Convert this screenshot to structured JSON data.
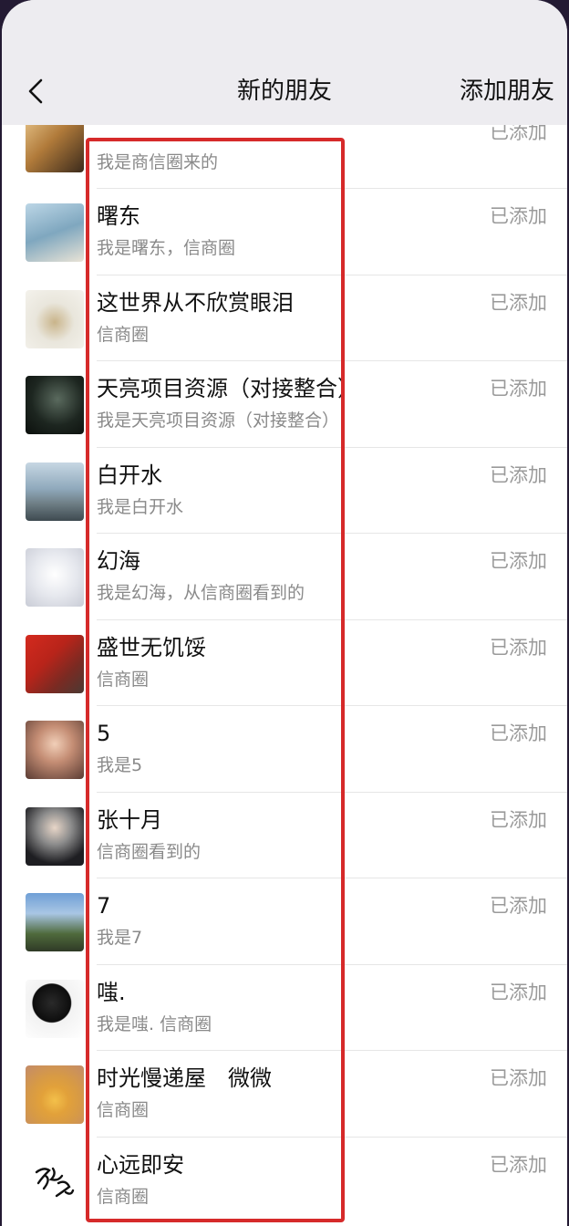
{
  "nav": {
    "back_icon": "chevron-left-icon",
    "title": "新的朋友",
    "add_label": "添加朋友"
  },
  "friends": [
    {
      "name": "",
      "message": "我是商信圈来的",
      "status": "已添加",
      "avatar": "photo"
    },
    {
      "name": "曙东",
      "message": "我是曙东，信商圈",
      "status": "已添加",
      "avatar": "photo"
    },
    {
      "name": "这世界从不欣赏眼泪",
      "message": "信商圈",
      "status": "已添加",
      "avatar": "photo"
    },
    {
      "name": "天亮项目资源（对接整合）",
      "message": "我是天亮项目资源（对接整合）",
      "status": "已添加",
      "avatar": "photo"
    },
    {
      "name": "白开水",
      "message": "我是白开水",
      "status": "已添加",
      "avatar": "photo"
    },
    {
      "name": "幻海",
      "message": "我是幻海，从信商圈看到的",
      "status": "已添加",
      "avatar": "photo"
    },
    {
      "name": "盛世无饥馁",
      "message": "信商圈",
      "status": "已添加",
      "avatar": "photo"
    },
    {
      "name": "5",
      "message": "我是5",
      "status": "已添加",
      "avatar": "photo"
    },
    {
      "name": "张十月",
      "message": "信商圈看到的",
      "status": "已添加",
      "avatar": "photo"
    },
    {
      "name": "7",
      "message": "我是7",
      "status": "已添加",
      "avatar": "photo"
    },
    {
      "name": "嗤.",
      "message": "我是嗤. 信商圈",
      "status": "已添加",
      "avatar": "photo"
    },
    {
      "name": "时光慢递屋　微微",
      "message": "信商圈",
      "status": "已添加",
      "avatar": "photo"
    },
    {
      "name": "心远即安",
      "message": "信商圈",
      "status": "已添加",
      "avatar": "calligraphy"
    }
  ],
  "colors": {
    "highlight_border": "#d62a2a",
    "nav_background": "#edecf0",
    "list_background": "#ffffff"
  }
}
